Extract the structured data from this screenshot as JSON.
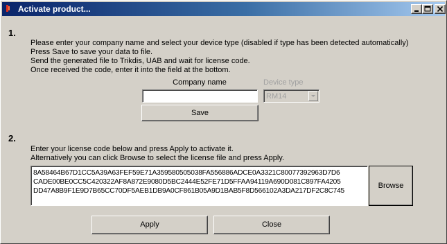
{
  "window": {
    "title": "Activate product...",
    "buttons": {
      "minimize_icon": "minimize-icon",
      "maximize_icon": "maximize-icon",
      "close_icon": "close-icon"
    }
  },
  "step1": {
    "number": "1.",
    "instructions": [
      "Please enter your company name and select your device type (disabled if type has been detected automatically)",
      "Press Save to save your data to file.",
      "Send the generated file to Trikdis, UAB and wait for license code.",
      "Once received the code, enter it into the field at the bottom."
    ],
    "company_label": "Company name",
    "company_value": "",
    "device_label": "Device type",
    "device_value": "RM14",
    "save_label": "Save"
  },
  "step2": {
    "number": "2.",
    "instructions": [
      "Enter your license code below and press Apply to activate it.",
      "Alternatively you can click Browse to select the license file and press Apply."
    ],
    "license_lines": [
      "8A58464B67D1CC5A39A63FEF59E71A359580505038FA556886ADCE0A3321C80077392963D7D6",
      "CADE00BE0CC5C420322AF8A872E9080D5BC2444E52FE71D5FFAA94119A690D081C897FA4205",
      "DD47A8B9F1E9D7B65CC70DF5AEB1DB9A0CF861B05A9D1BAB5F8D566102A3DA217DF2C8C745"
    ],
    "browse_label": "Browse"
  },
  "footer": {
    "apply_label": "Apply",
    "close_label": "Close"
  }
}
